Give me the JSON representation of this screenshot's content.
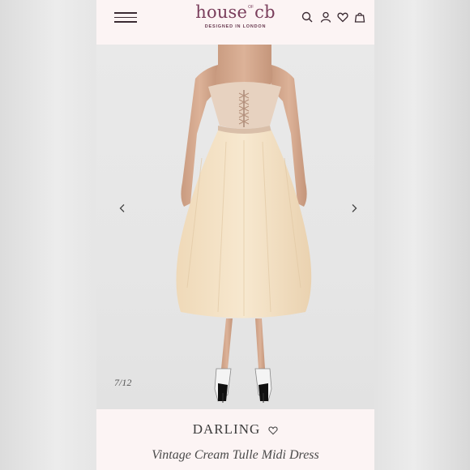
{
  "brand": {
    "logo_left": "house",
    "logo_of": "OF",
    "logo_right": "cb",
    "tagline": "DESIGNED IN LONDON"
  },
  "header_icons": [
    "menu-icon",
    "search-icon",
    "account-icon",
    "heart-icon",
    "bag-icon"
  ],
  "gallery": {
    "counter": "7/12",
    "prev_icon": "chevron-left-icon",
    "next_icon": "chevron-right-icon"
  },
  "product": {
    "name": "DARLING",
    "subtitle": "Vintage Cream Tulle Midi Dress",
    "wishlist_icon": "heart-icon"
  },
  "colors": {
    "brand": "#7a3e5c",
    "background": "#f7eeee",
    "dress": "#f3e2c7"
  }
}
